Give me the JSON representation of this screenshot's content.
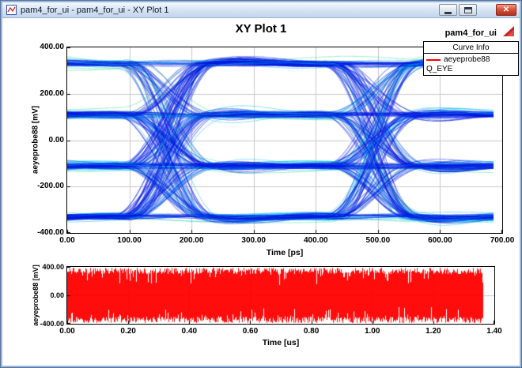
{
  "window": {
    "title": "pam4_for_ui - pam4_for_ui - XY Plot 1",
    "buttons": {
      "close_glyph": "✕"
    }
  },
  "report": {
    "title": "XY Plot 1",
    "design_name": "pam4_for_ui",
    "legend": {
      "header": "Curve Info",
      "entries": [
        {
          "name": "aeyeprobe88",
          "quantity": "Q_EYE",
          "color": "#ff0000"
        }
      ]
    }
  },
  "plot_main": {
    "ylabel": "aeyeprobe88 [mV]",
    "xlabel": "Time [ps]",
    "yticks": [
      "400.00",
      "200.00",
      "0.00",
      "-200.00",
      "-400.00"
    ],
    "xticks": [
      "0.00",
      "100.00",
      "200.00",
      "300.00",
      "400.00",
      "500.00",
      "600.00",
      "700.00"
    ]
  },
  "plot_bottom": {
    "ylabel": "aeyeprobe88 [mV]",
    "xlabel": "Time [us]",
    "yticks": [
      "400.00",
      "0.00",
      "-400.00"
    ],
    "xticks": [
      "0.00",
      "0.20",
      "0.40",
      "0.60",
      "0.80",
      "1.00",
      "1.20",
      "1.40"
    ]
  },
  "chart_data": [
    {
      "type": "line",
      "subtype": "eye_diagram",
      "title": "XY Plot 1",
      "series": [
        {
          "name": "aeyeprobe88",
          "quantity": "Q_EYE"
        }
      ],
      "xlabel": "Time [ps]",
      "ylabel": "aeyeprobe88 [mV]",
      "xlim": [
        0,
        700
      ],
      "ylim": [
        -400,
        400
      ],
      "xtick_step": 100,
      "ytick_step": 200,
      "grid": true,
      "grid_color": "#c9c9c9",
      "data_time_span_ps": [
        0,
        686
      ],
      "pam4_levels_mV": [
        330,
        110,
        -110,
        -330
      ],
      "symbol_period_ps": 333,
      "eye_crossing_times_ps": [
        161,
        494
      ],
      "density_colors": [
        "#0013e0",
        "#00b8f0",
        "#00d87a"
      ],
      "legend_position": "top-right"
    },
    {
      "type": "line",
      "subtype": "dense_waveform",
      "series": [
        {
          "name": "aeyeprobe88",
          "quantity": "Q_EYE"
        }
      ],
      "xlabel": "Time [us]",
      "ylabel": "aeyeprobe88 [mV]",
      "xlim": [
        0,
        1.4
      ],
      "ylim": [
        -400,
        400
      ],
      "xtick_step": 0.2,
      "ytick_step": 400,
      "grid": true,
      "grid_color": "#c9c9c9",
      "data_time_span_us": [
        0,
        1.36
      ],
      "amplitude_mV": [
        -390,
        390
      ],
      "color": "#ff0000"
    }
  ]
}
